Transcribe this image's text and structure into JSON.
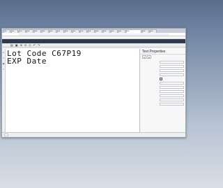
{
  "browser": {
    "tabs": [
      "Tab",
      "Tab",
      "Tab",
      "Tab",
      "Tab",
      "Tab",
      "Tab",
      "Tab",
      "Tab",
      "Tab",
      "Tab",
      "Tab",
      "Tab",
      "Tab",
      "Tab",
      "Tab",
      "Tab",
      "Tab",
      "Tab"
    ],
    "active_tab_index": 16,
    "url": "",
    "bookmarks": [
      "",
      "",
      "",
      "",
      "",
      "",
      "",
      "",
      "",
      "",
      ""
    ]
  },
  "app": {
    "logo": "",
    "title": "",
    "toolbar_icons": [
      "document-icon",
      "save-icon",
      "zoom-in-icon",
      "zoom-out-icon",
      "zoom-fit-icon",
      "undo-icon",
      "redo-icon"
    ]
  },
  "canvas": {
    "lines": [
      "Lot Code C67P19",
      "EXP Date"
    ]
  },
  "panel": {
    "title": "Text Properties",
    "tab_labels": [
      "A",
      "Q"
    ],
    "rows": [
      {
        "label": "",
        "value": "",
        "type": "field"
      },
      {
        "label": "",
        "value": "",
        "type": "field"
      },
      {
        "label": "",
        "value": "",
        "type": "field"
      },
      {
        "label": "",
        "value": "",
        "type": "field"
      },
      {
        "label": "",
        "value": "",
        "type": "checkbox"
      },
      {
        "label": "",
        "value": "",
        "type": "field"
      },
      {
        "label": "",
        "value": "",
        "type": "field"
      },
      {
        "label": "",
        "value": "",
        "type": "field"
      },
      {
        "label": "",
        "value": "",
        "type": "field"
      },
      {
        "label": "",
        "value": "",
        "type": "field"
      },
      {
        "label": "",
        "value": "",
        "type": "field"
      }
    ]
  },
  "status": {
    "chip": ""
  }
}
